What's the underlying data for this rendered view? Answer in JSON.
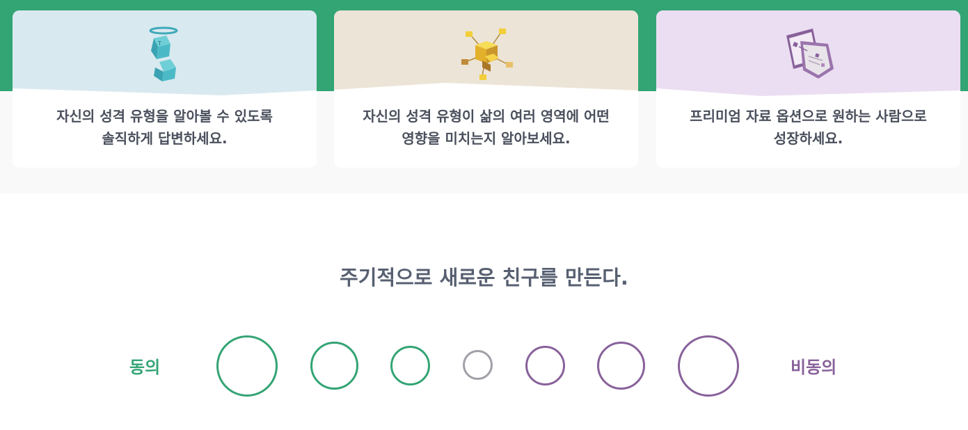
{
  "cards": [
    {
      "line1": "자신의 성격 유형을 알아볼 수 있도록",
      "line2": "솔직하게 답변하세요.",
      "bg": "#d9e9f0",
      "icon": "teal-cubes-halo-icon"
    },
    {
      "line1": "자신의 성격 유형이 삶의 여러 영역에 어떤",
      "line2": "영향을 미치는지 알아보세요.",
      "bg": "#ece4d6",
      "icon": "gold-cubes-network-icon"
    },
    {
      "line1": "프리미엄 자료 옵션으로 원하는 사람으로",
      "line2": "성장하세요.",
      "bg": "#ebdef2",
      "icon": "purple-documents-icon"
    }
  ],
  "question": {
    "text": "주기적으로 새로운 친구를 만든다."
  },
  "scale": {
    "agree_label": "동의",
    "disagree_label": "비동의",
    "agree_color": "#33a474",
    "neutral_color": "#9fa0a8",
    "disagree_color": "#88619a",
    "options": 7
  },
  "colors": {
    "brand_green": "#33a474",
    "text": "#4a4f5c",
    "question": "#576071"
  }
}
